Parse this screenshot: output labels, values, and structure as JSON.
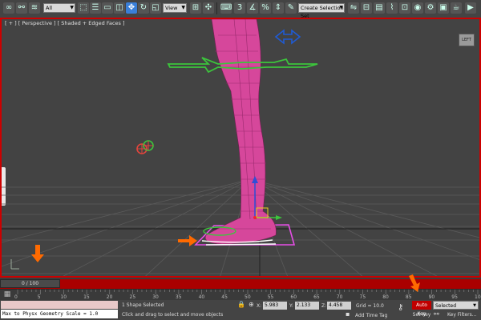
{
  "toolbar": {
    "selection_filter": "All",
    "reference_coord": "View",
    "named_selection": "Create Selection Set",
    "tools": [
      "link-icon",
      "unlink-icon",
      "bind-spacewarp-icon",
      "select-object-icon",
      "select-by-name-icon",
      "rect-selection-icon",
      "window-crossing-icon",
      "select-move-icon",
      "select-rotate-icon",
      "select-scale-icon",
      "pivot-icon",
      "snaps-icon",
      "angle-snap-icon",
      "percent-snap-icon",
      "spinner-snap-icon",
      "edit-named-sets-icon",
      "mirror-icon",
      "align-icon",
      "layer-icon",
      "graph-editors-icon",
      "material-editor-icon",
      "render-setup-icon",
      "rendered-frame-icon",
      "render-icon"
    ]
  },
  "viewport": {
    "label": "[ + ] [ Perspective ] [ Shaded + Edged Faces ]",
    "view_cube": "LEFT"
  },
  "timeline": {
    "frame_display": "0 / 100",
    "ticks": [
      "0",
      "5",
      "10",
      "15",
      "20",
      "25",
      "30",
      "35",
      "40",
      "45",
      "50",
      "55",
      "60",
      "65",
      "70",
      "75",
      "80",
      "85",
      "90",
      "95",
      "100"
    ]
  },
  "status": {
    "listener_text": "Max to Physx Geometry Scale = 1.0",
    "selection_info": "1 Shape Selected",
    "prompt": "Click and drag to select and move objects",
    "x_label": "X:",
    "x_value": "5.983",
    "y_label": "Y:",
    "y_value": "2.133",
    "z_label": "Z:",
    "z_value": "4.458",
    "grid": "Grid = 10.0",
    "add_time_tag": "Add Time Tag",
    "auto_key": "Auto Key",
    "set_key": "Set Key",
    "key_mode": "Selected",
    "key_filters": "Key Filters..."
  },
  "colors": {
    "viewport_border": "#cc0000",
    "time_slider": "#aa0000",
    "leg_mesh": "#d6479b",
    "helper_green": "#3cc53c",
    "selection_box": "#e64ee6",
    "arrow_orange": "#ff6a00",
    "move_gizmo_blue": "#1f5bd6"
  }
}
